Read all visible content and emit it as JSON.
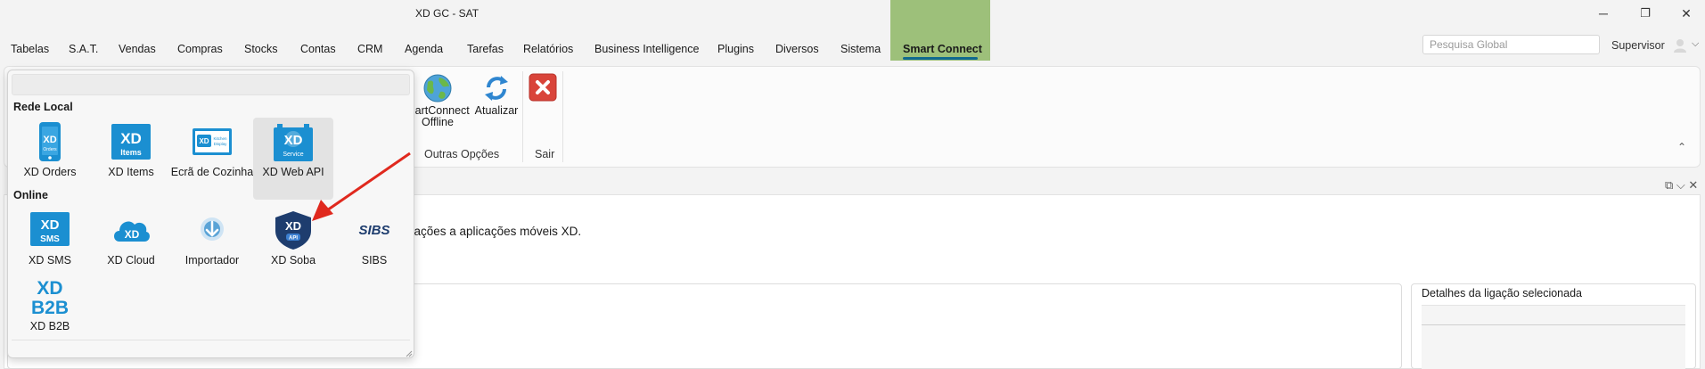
{
  "window": {
    "title": "XD GC - SAT",
    "min_glyph": "─",
    "max_glyph": "❐",
    "close_glyph": "✕"
  },
  "menu": {
    "items": [
      "Tabelas",
      "S.A.T.",
      "Vendas",
      "Compras",
      "Stocks",
      "Contas",
      "CRM",
      "Agenda",
      "Tarefas",
      "Relatórios",
      "Business Intelligence",
      "Plugins",
      "Diversos",
      "Sistema"
    ],
    "active": "Smart Connect"
  },
  "search": {
    "placeholder": "Pesquisa Global"
  },
  "user": {
    "name": "Supervisor",
    "chevron": "⌵"
  },
  "ribbon": {
    "smartconnect_offline": "martConnect Offline",
    "atualizar": "Atualizar",
    "outras_opcoes": "Outras Opções",
    "sair": "Sair",
    "collapse_glyph": "⌃"
  },
  "popup": {
    "rede_local_title": "Rede Local",
    "online_title": "Online",
    "rede_local": [
      {
        "label": "XD Orders",
        "icon": "xd-orders-icon",
        "badge": "XD",
        "sub": "Orders"
      },
      {
        "label": "XD Items",
        "icon": "xd-items-icon",
        "badge": "XD",
        "sub": "Items"
      },
      {
        "label": "Ecrã de Cozinha",
        "icon": "kitchen-display-icon",
        "badge": "XD",
        "sub": "Kitchen Display"
      },
      {
        "label": "XD Web API",
        "icon": "xd-web-api-icon",
        "badge": "XD",
        "sub": "Service",
        "selected": true
      }
    ],
    "online": [
      {
        "label": "XD SMS",
        "icon": "xd-sms-icon",
        "badge": "XD",
        "sub": "SMS"
      },
      {
        "label": "XD Cloud",
        "icon": "xd-cloud-icon",
        "badge": "XD",
        "sub": ""
      },
      {
        "label": "Importador",
        "icon": "importer-icon",
        "badge": "",
        "sub": ""
      },
      {
        "label": "XD Soba",
        "icon": "xd-soba-icon",
        "badge": "XD",
        "sub": "API"
      },
      {
        "label": "SIBS",
        "icon": "sibs-icon",
        "badge": "SIBS",
        "sub": ""
      },
      {
        "label": "XD B2B",
        "icon": "xd-b2b-icon",
        "badge": "XD",
        "sub": "B2B"
      }
    ]
  },
  "content": {
    "description": "igações a aplicações móveis XD.",
    "right_panel_title": "Detalhes da ligação selecionada",
    "toolbar_glyphs": "⧉ ⌵ ✕"
  },
  "colors": {
    "accent_tab": "#9dc07a",
    "accent_underline": "#0f6a8f",
    "xd_blue": "#1b8fd1",
    "soba_navy": "#1e3d6e",
    "close_red": "#d9443a",
    "arrow_red": "#e0291e"
  }
}
